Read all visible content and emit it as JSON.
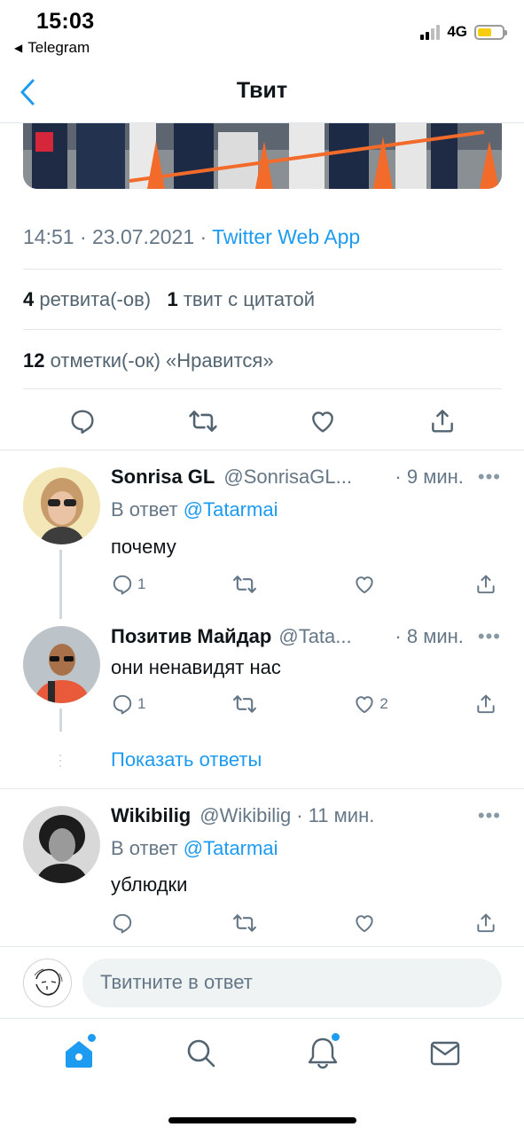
{
  "status_bar": {
    "time": "15:03",
    "back_app": "Telegram",
    "network": "4G"
  },
  "nav": {
    "title": "Твит"
  },
  "tweet": {
    "timestamp": "14:51 · 23.07.2021 · ",
    "source": "Twitter Web App",
    "retweets_count": "4",
    "retweets_label": "ретвита(-ов)",
    "quotes_count": "1",
    "quotes_label": "твит с цитатой",
    "likes_count": "12",
    "likes_label": "отметки(-ок) «Нравится»"
  },
  "replies": [
    {
      "name": "Sonrisa GL",
      "handle": "@SonrisaGL...",
      "time": "· 9 мин.",
      "reply_prefix": "В ответ",
      "reply_to": "@Tatarmai",
      "text": "почему",
      "reply_count": "1",
      "like_count": ""
    },
    {
      "name": "Позитив Майдар",
      "handle": "@Tata...",
      "time": "· 8 мин.",
      "text": "они ненавидят нас",
      "reply_count": "1",
      "like_count": "2"
    },
    {
      "name": "Wikibilig",
      "handle": "@Wikibilig",
      "time": "· 11 мин.",
      "reply_prefix": "В ответ",
      "reply_to": "@Tatarmai",
      "text": "ублюдки",
      "reply_count": "",
      "like_count": ""
    }
  ],
  "show_replies": "Показать ответы",
  "more_label": "•••",
  "composer": {
    "placeholder": "Твитните в ответ"
  },
  "colors": {
    "accent": "#1d9bf0",
    "secondary_text": "#657786",
    "divider": "#e1e8ed"
  },
  "icons": {
    "actions": [
      "reply-icon",
      "retweet-icon",
      "like-icon",
      "share-icon"
    ],
    "tabs": [
      "home-icon",
      "search-icon",
      "notifications-icon",
      "messages-icon"
    ]
  }
}
